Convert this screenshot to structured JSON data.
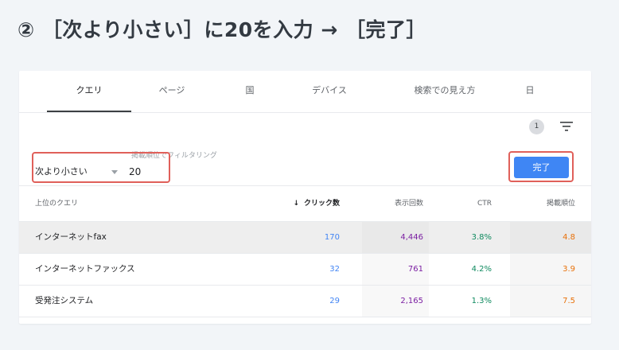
{
  "headline": "② ［次より小さい］に20を入力 → ［完了］",
  "tabs": [
    {
      "label": "クエリ",
      "active": true
    },
    {
      "label": "ページ",
      "active": false
    },
    {
      "label": "国",
      "active": false
    },
    {
      "label": "デバイス",
      "active": false
    },
    {
      "label": "検索での見え方",
      "active": false
    },
    {
      "label": "日",
      "active": false
    }
  ],
  "filter_count": "1",
  "filter_editor": {
    "label": "掲載順位でフィルタリング",
    "condition": "次より小さい",
    "value": "20",
    "done_label": "完了"
  },
  "table": {
    "headers": {
      "query": "上位のクエリ",
      "clicks": "クリック数",
      "impressions": "表示回数",
      "ctr": "CTR",
      "position": "掲載順位"
    },
    "rows": [
      {
        "query": "インターネットfax",
        "clicks": "170",
        "impressions": "4,446",
        "ctr": "3.8%",
        "position": "4.8"
      },
      {
        "query": "インターネットファックス",
        "clicks": "32",
        "impressions": "761",
        "ctr": "4.2%",
        "position": "3.9"
      },
      {
        "query": "受発注システム",
        "clicks": "29",
        "impressions": "2,165",
        "ctr": "1.3%",
        "position": "7.5"
      }
    ]
  },
  "colors": {
    "highlight": "#e0605a",
    "done_button": "#3f86f4",
    "clicks": "#4285f4",
    "impressions": "#7b1fa2",
    "ctr": "#0f8a5f",
    "position": "#e8710a"
  },
  "icons": [
    "filter-icon",
    "sort-down-arrow-icon",
    "dropdown-caret-icon"
  ]
}
